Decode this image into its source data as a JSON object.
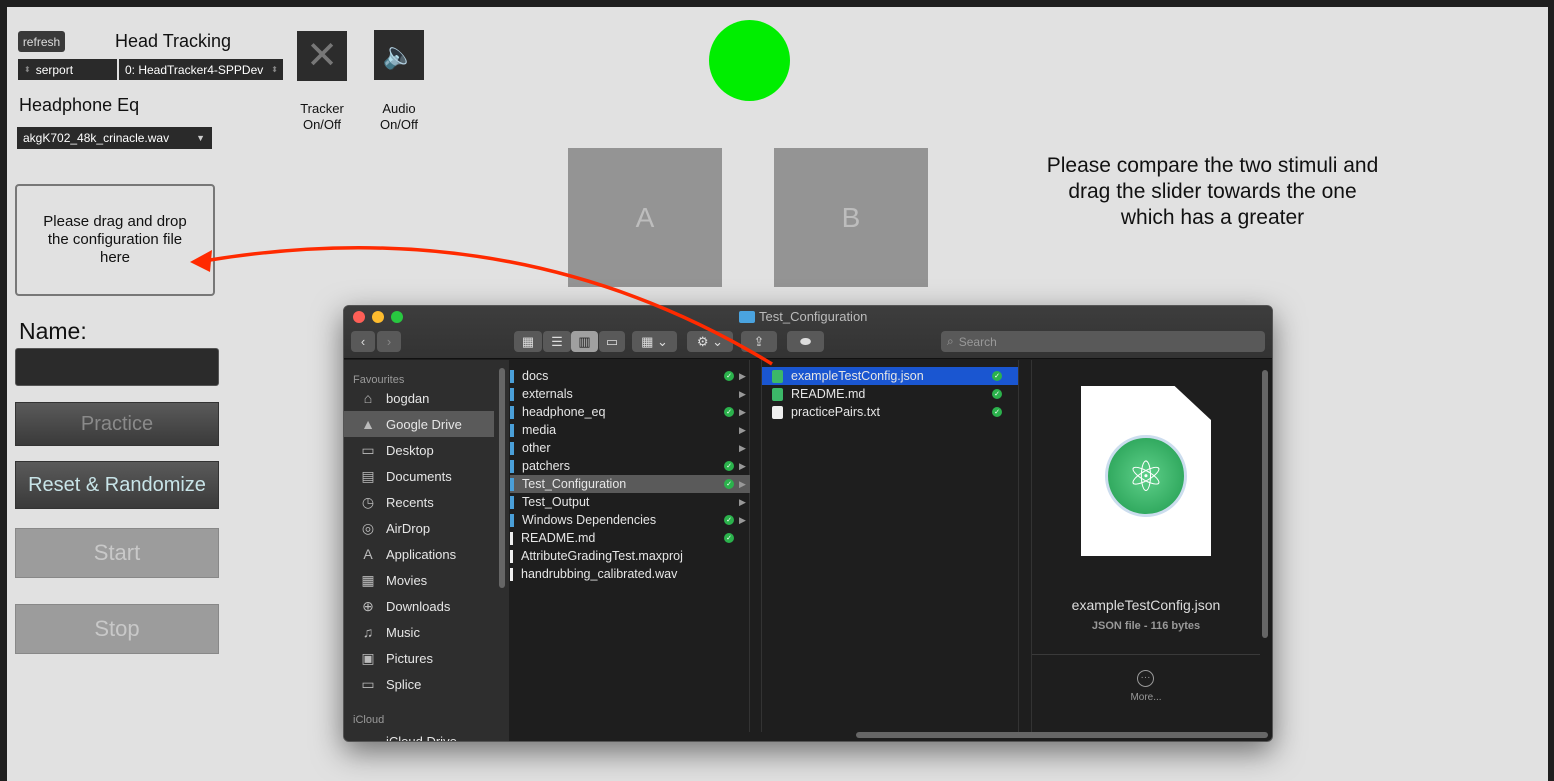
{
  "controls": {
    "refresh": "refresh",
    "head_tracking": "Head Tracking",
    "serport": "serport",
    "tracker_device": "0: HeadTracker4-SPPDev",
    "headphone_eq": "Headphone Eq",
    "eq_file": "akgK702_48k_crinacle.wav",
    "tracker_label": "Tracker On/Off",
    "audio_label": "Audio On/Off"
  },
  "dropzone": "Please drag and drop the configuration file here",
  "name_label": "Name:",
  "name_value": "",
  "buttons": {
    "practice": "Practice",
    "reset": "Reset & Randomize",
    "start": "Start",
    "stop": "Stop"
  },
  "stimuli": {
    "a": "A",
    "b": "B"
  },
  "instructions": "Please compare the two stimuli and drag the slider towards the one which has a greater",
  "indicator_color": "#00ee00",
  "finder": {
    "title": "Test_Configuration",
    "search_placeholder": "Search",
    "favourites_label": "Favourites",
    "icloud_label": "iCloud",
    "sidebar": [
      {
        "label": "bogdan",
        "icon": "home-icon"
      },
      {
        "label": "Google Drive",
        "icon": "drive-icon"
      },
      {
        "label": "Desktop",
        "icon": "desktop-icon"
      },
      {
        "label": "Documents",
        "icon": "documents-icon"
      },
      {
        "label": "Recents",
        "icon": "clock-icon"
      },
      {
        "label": "AirDrop",
        "icon": "airdrop-icon"
      },
      {
        "label": "Applications",
        "icon": "applications-icon"
      },
      {
        "label": "Movies",
        "icon": "movies-icon"
      },
      {
        "label": "Downloads",
        "icon": "downloads-icon"
      },
      {
        "label": "Music",
        "icon": "music-icon"
      },
      {
        "label": "Pictures",
        "icon": "pictures-icon"
      },
      {
        "label": "Splice",
        "icon": "folder-icon"
      }
    ],
    "icloud_items": [
      {
        "label": "iCloud Drive"
      }
    ],
    "col1": [
      {
        "name": "docs",
        "synced": true,
        "folder": true
      },
      {
        "name": "externals",
        "synced": false,
        "folder": true
      },
      {
        "name": "headphone_eq",
        "synced": true,
        "folder": true
      },
      {
        "name": "media",
        "synced": false,
        "folder": true
      },
      {
        "name": "other",
        "synced": false,
        "folder": true
      },
      {
        "name": "patchers",
        "synced": true,
        "folder": true
      },
      {
        "name": "Test_Configuration",
        "synced": true,
        "folder": true
      },
      {
        "name": "Test_Output",
        "synced": false,
        "folder": true
      },
      {
        "name": "Windows Dependencies",
        "synced": true,
        "folder": true
      },
      {
        "name": "README.md",
        "synced": true,
        "folder": false
      },
      {
        "name": "AttributeGradingTest.maxproj",
        "synced": false,
        "folder": false
      },
      {
        "name": "handrubbing_calibrated.wav",
        "synced": false,
        "folder": false
      }
    ],
    "col2": [
      {
        "name": "exampleTestConfig.json",
        "synced": true
      },
      {
        "name": "README.md",
        "synced": true
      },
      {
        "name": "practicePairs.txt",
        "synced": true
      }
    ],
    "preview": {
      "name": "exampleTestConfig.json",
      "kind": "JSON file - 116 bytes",
      "more": "More..."
    }
  }
}
